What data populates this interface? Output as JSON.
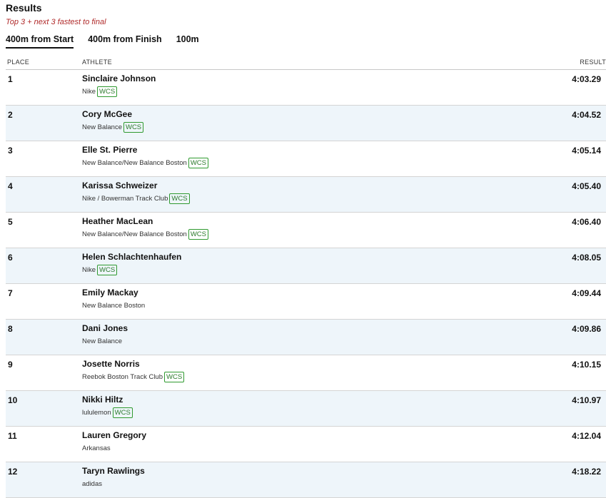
{
  "header": {
    "title": "Results",
    "subtitle": "Top 3 + next 3 fastest to final"
  },
  "tabs": [
    {
      "label": "400m from Start",
      "active": true
    },
    {
      "label": "400m from Finish",
      "active": false
    },
    {
      "label": "100m",
      "active": false
    }
  ],
  "table": {
    "columns": {
      "place": "PLACE",
      "athlete": "ATHLETE",
      "result": "RESULT"
    },
    "rows": [
      {
        "place": "1",
        "name": "Sinclaire Johnson",
        "team": "Nike",
        "badge": "WCS",
        "result": "4:03.29"
      },
      {
        "place": "2",
        "name": "Cory McGee",
        "team": "New Balance",
        "badge": "WCS",
        "result": "4:04.52"
      },
      {
        "place": "3",
        "name": "Elle St. Pierre",
        "team": "New Balance/New Balance Boston",
        "badge": "WCS",
        "result": "4:05.14"
      },
      {
        "place": "4",
        "name": "Karissa Schweizer",
        "team": "Nike / Bowerman Track Club",
        "badge": "WCS",
        "result": "4:05.40"
      },
      {
        "place": "5",
        "name": "Heather MacLean",
        "team": "New Balance/New Balance Boston",
        "badge": "WCS",
        "result": "4:06.40"
      },
      {
        "place": "6",
        "name": "Helen Schlachtenhaufen",
        "team": "Nike",
        "badge": "WCS",
        "result": "4:08.05"
      },
      {
        "place": "7",
        "name": "Emily Mackay",
        "team": "New Balance Boston",
        "badge": "",
        "result": "4:09.44"
      },
      {
        "place": "8",
        "name": "Dani Jones",
        "team": "New Balance",
        "badge": "",
        "result": "4:09.86"
      },
      {
        "place": "9",
        "name": "Josette Norris",
        "team": "Reebok Boston Track Club",
        "badge": "WCS",
        "result": "4:10.15"
      },
      {
        "place": "10",
        "name": "Nikki Hiltz",
        "team": "lululemon",
        "badge": "WCS",
        "result": "4:10.97"
      },
      {
        "place": "11",
        "name": "Lauren Gregory",
        "team": "Arkansas",
        "badge": "",
        "result": "4:12.04"
      },
      {
        "place": "12",
        "name": "Taryn Rawlings",
        "team": "adidas",
        "badge": "",
        "result": "4:18.22"
      }
    ]
  },
  "colors": {
    "subtitle": "#b02a2a",
    "alt_row_bg": "#eef5fa",
    "badge_border": "#2f9a2f"
  }
}
